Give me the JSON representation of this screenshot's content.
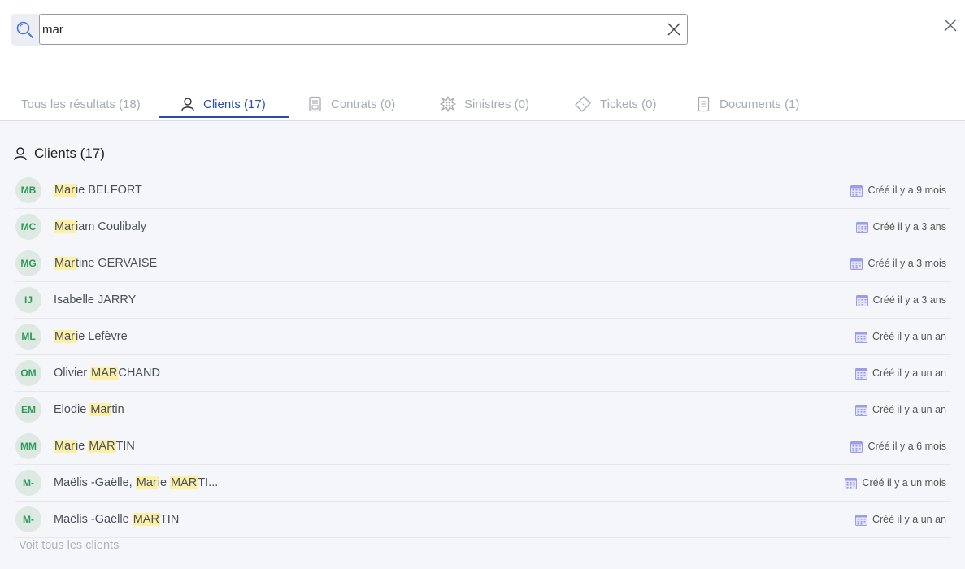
{
  "search": {
    "value": "mar"
  },
  "tabs": [
    {
      "label": "Tous les résultats (18)",
      "icon": "none",
      "active": false
    },
    {
      "label": "Clients (17)",
      "icon": "user-icon",
      "active": true
    },
    {
      "label": "Contrats (0)",
      "icon": "contract-icon",
      "active": false
    },
    {
      "label": "Sinistres (0)",
      "icon": "burst-icon",
      "active": false
    },
    {
      "label": "Tickets (0)",
      "icon": "ticket-icon",
      "active": false
    },
    {
      "label": "Documents (1)",
      "icon": "document-icon",
      "active": false
    }
  ],
  "section": {
    "title": "Clients (17)",
    "icon": "user-icon"
  },
  "clients": [
    {
      "initials": "MB",
      "name_parts": [
        {
          "t": "Mar",
          "h": true
        },
        {
          "t": "ie BELFORT",
          "h": false
        }
      ],
      "created": "Créé il y a 9 mois"
    },
    {
      "initials": "MC",
      "name_parts": [
        {
          "t": "Mar",
          "h": true
        },
        {
          "t": "iam Coulibaly",
          "h": false
        }
      ],
      "created": "Créé il y a 3 ans"
    },
    {
      "initials": "MG",
      "name_parts": [
        {
          "t": "Mar",
          "h": true
        },
        {
          "t": "tine GERVAISE",
          "h": false
        }
      ],
      "created": "Créé il y a 3 mois"
    },
    {
      "initials": "IJ",
      "name_parts": [
        {
          "t": "Isabelle JARRY",
          "h": false
        }
      ],
      "created": "Créé il y a 3 ans"
    },
    {
      "initials": "ML",
      "name_parts": [
        {
          "t": "Mar",
          "h": true
        },
        {
          "t": "ie Lefèvre",
          "h": false
        }
      ],
      "created": "Créé il y a un an"
    },
    {
      "initials": "OM",
      "name_parts": [
        {
          "t": "Olivier ",
          "h": false
        },
        {
          "t": "MAR",
          "h": true
        },
        {
          "t": "CHAND",
          "h": false
        }
      ],
      "created": "Créé il y a un an"
    },
    {
      "initials": "EM",
      "name_parts": [
        {
          "t": "Elodie ",
          "h": false
        },
        {
          "t": "Mar",
          "h": true
        },
        {
          "t": "tin",
          "h": false
        }
      ],
      "created": "Créé il y a un an"
    },
    {
      "initials": "MM",
      "name_parts": [
        {
          "t": "Mar",
          "h": true
        },
        {
          "t": "ie ",
          "h": false
        },
        {
          "t": "MAR",
          "h": true
        },
        {
          "t": "TIN",
          "h": false
        }
      ],
      "created": "Créé il y a 6 mois"
    },
    {
      "initials": "M-",
      "name_parts": [
        {
          "t": "Maëlis -Gaëlle, ",
          "h": false
        },
        {
          "t": "Mar",
          "h": true
        },
        {
          "t": "ie ",
          "h": false
        },
        {
          "t": "MAR",
          "h": true
        },
        {
          "t": "TI...",
          "h": false
        }
      ],
      "created": "Créé il y a un mois"
    },
    {
      "initials": "M-",
      "name_parts": [
        {
          "t": "Maëlis -Gaëlle ",
          "h": false
        },
        {
          "t": "MAR",
          "h": true
        },
        {
          "t": "TIN",
          "h": false
        }
      ],
      "created": "Créé il y a un an"
    }
  ],
  "see_all_label": "Voit tous les clients",
  "colors": {
    "accent": "#2d4ea2",
    "avatar_bg": "#dde9e2",
    "avatar_text": "#2e9a57",
    "highlight": "#fbf0a6",
    "calendar_icon": "#9b9ee6"
  }
}
